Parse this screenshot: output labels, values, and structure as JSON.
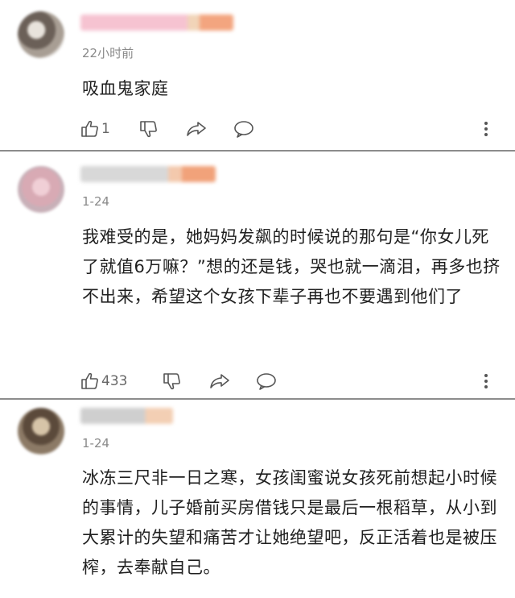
{
  "comments": [
    {
      "time": "22小时前",
      "text": "吸血鬼家庭",
      "likes": "1",
      "icons": [
        "thumbs-up-icon",
        "thumbs-down-icon",
        "share-icon",
        "reply-icon",
        "more-icon"
      ]
    },
    {
      "time": "1-24",
      "text": "我难受的是，她妈妈发飙的时候说的那句是“你女儿死了就值6万嘛？”想的还是钱，哭也就一滴泪，再多也挤不出来，希望这个女孩下辈子再也不要遇到他们了",
      "likes": "433",
      "icons": [
        "thumbs-up-icon",
        "thumbs-down-icon",
        "share-icon",
        "reply-icon",
        "more-icon"
      ]
    },
    {
      "time": "1-24",
      "text": "冰冻三尺非一日之寒，女孩闺蜜说女孩死前想起小时候的事情，儿子婚前买房借钱只是最后一根稻草，从小到大累计的失望和痛苦才让她绝望吧，反正活着也是被压榨，去奉献自己。",
      "likes": "",
      "icons": []
    }
  ]
}
